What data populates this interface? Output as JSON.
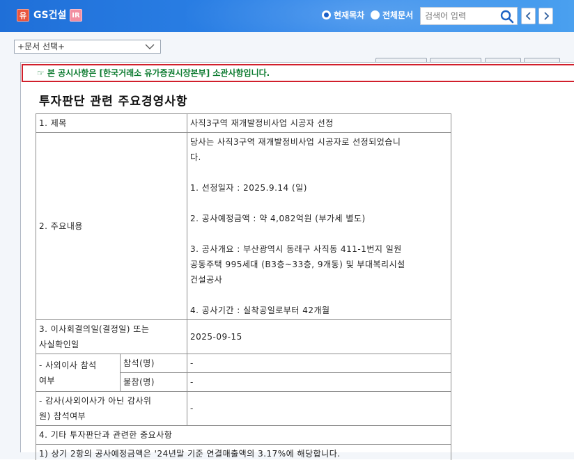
{
  "header": {
    "badge_market": "유",
    "company": "GS건설",
    "badge_ir": "IR",
    "radio_current": "현재목차",
    "radio_all": "전체문서",
    "search_placeholder": "검색어 입력"
  },
  "doc_select": {
    "label": "+문서 선택+"
  },
  "notice": "☞ 본 공시사항은 [한국거래소 유가증권시장본부] 소관사항입니다.",
  "title": "투자판단 관련 주요경영사항",
  "table": {
    "r1_label": "1. 제목",
    "r1_value": "사직3구역 재개발정비사업 시공자 선정",
    "r2_label": "2. 주요내용",
    "r2_lines": [
      "당사는 사직3구역 재개발정비사업 시공자로 선정되었습니",
      "다.",
      "",
      "1. 선정일자 : 2025.9.14 (일)",
      "",
      "2. 공사예정금액 : 약 4,082억원 (부가세 별도)",
      "",
      "3. 공사개요 : 부산광역시 동래구 사직동 411-1번지 일원",
      "공동주택 995세대 (B3층~33층, 9개동) 및 부대복리시설",
      "건설공사",
      "",
      "4. 공사기간 : 실착공일로부터 42개월"
    ],
    "r3_label_1": "3. 이사회결의일(결정일) 또는",
    "r3_label_2": "사실확인일",
    "r3_value": "2025-09-15",
    "r4_label_1": "- 사외이사 참석",
    "r4_label_2": "여부",
    "r4_attend": "참석(명)",
    "r4_attend_value": "-",
    "r4_absent": "불참(명)",
    "r4_absent_value": "-",
    "r5_label_1": "- 감사(사외이사가 아닌 감사위",
    "r5_label_2": "원) 참석여부",
    "r5_value": "-",
    "r6_label": "4. 기타 투자판단과 관련한 중요사항",
    "r7_text": "1) 상기 2항의 공사예정금액은 '24년말 기준 연결매출액의 3.17%에 해당합니다."
  },
  "colors": {
    "header_blue": "#2f86ea",
    "notice_border": "#d11f2b",
    "notice_text": "#0a7a2e"
  },
  "icons": [
    "search-icon",
    "chevron-left-icon",
    "chevron-right-icon",
    "chevron-down-icon"
  ]
}
